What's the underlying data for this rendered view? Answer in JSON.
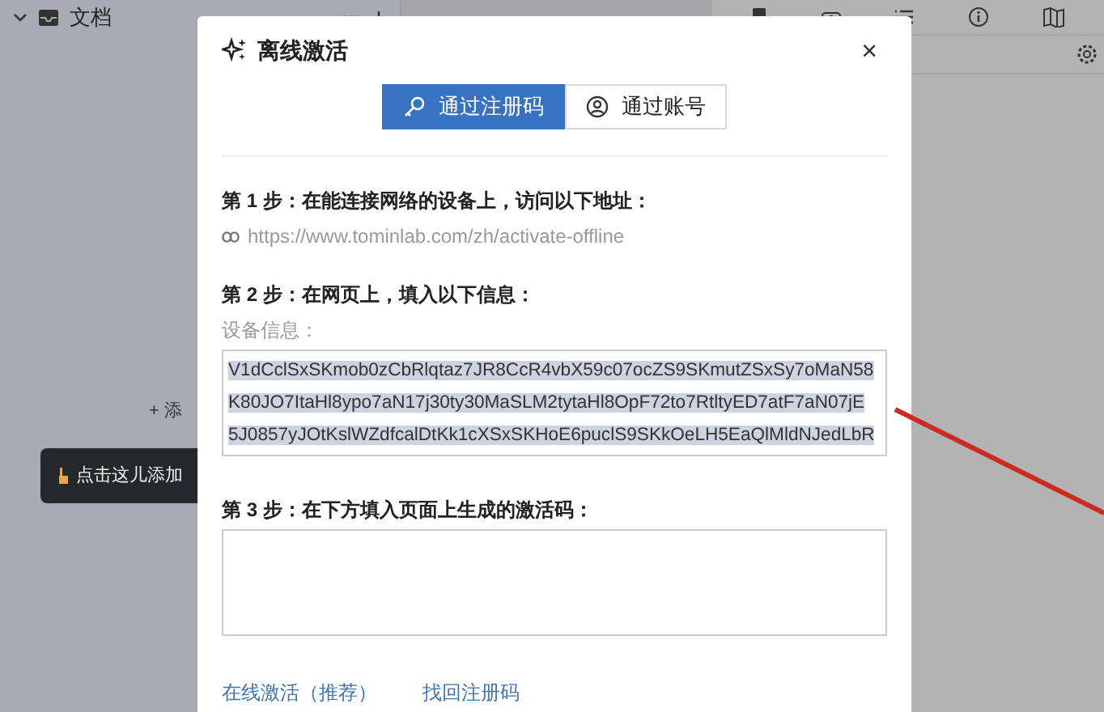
{
  "app": {
    "sidebar_title": "文档",
    "add_item": "+ 添",
    "tooltip": "点击这儿添加"
  },
  "dialog": {
    "title": "离线激活",
    "close": "×",
    "tabs": [
      {
        "label": "通过注册码",
        "selected": true,
        "kind": "key"
      },
      {
        "label": "通过账号",
        "selected": false,
        "kind": "user"
      }
    ],
    "step1": {
      "heading": "第 1 步：在能连接网络的设备上，访问以下地址：",
      "url": "https://www.tominlab.com/zh/activate-offline"
    },
    "step2": {
      "heading": "第 2 步：在网页上，填入以下信息：",
      "label": "设备信息：",
      "selected": true,
      "lines": [
        "V1dCclSxSKmob0zCbRlqtaz7JR8CcR4vbX59c07ocZS9SKmutZSxSy7oMaN58",
        "K80JO7ItaHl8ypo7aN17j30ty30MaSLM2tytaHl8OpF72to7RtltyED7atF7aN07jE",
        "5J0857yJOtKslWZdfcalDtKk1cXSxSKHoE6puclS9SKkOeLH5EaQlMldNJedLbR"
      ]
    },
    "step3": {
      "heading": "第 3 步：在下方填入页面上生成的激活码："
    },
    "links": [
      "在线激活（推荐）",
      "找回注册码"
    ]
  }
}
